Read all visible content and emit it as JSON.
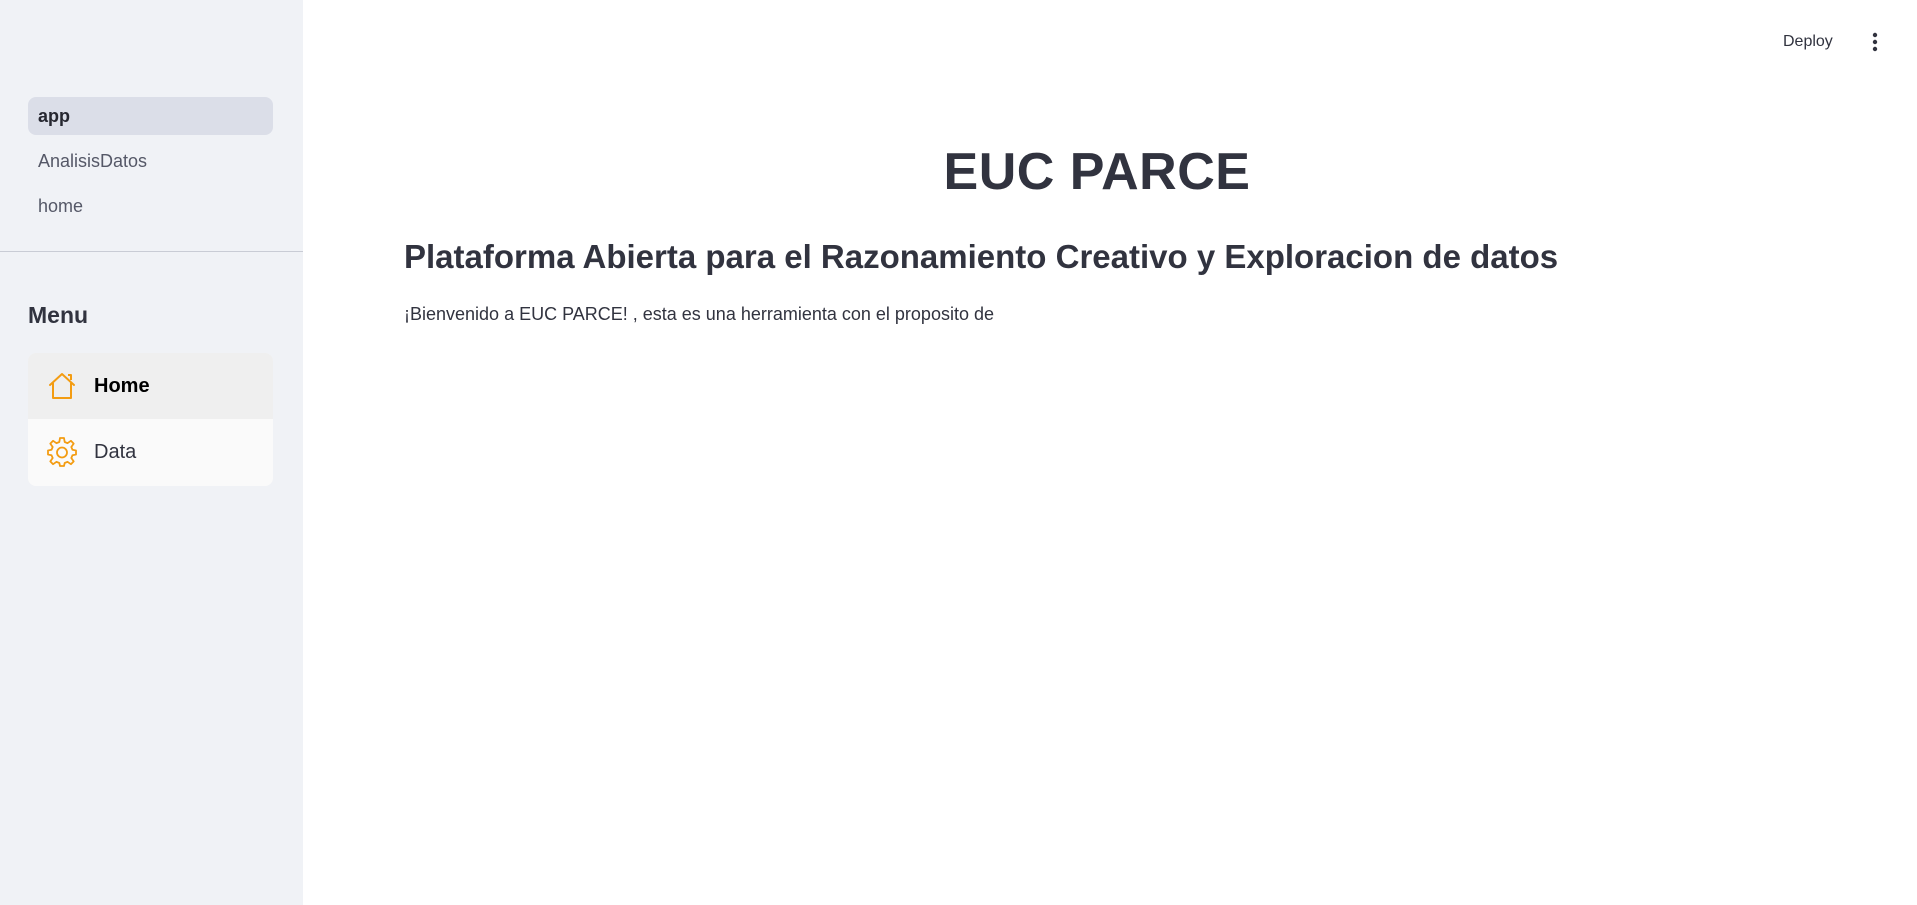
{
  "sidebar": {
    "pages": [
      {
        "label": "app",
        "active": true
      },
      {
        "label": "AnalisisDatos",
        "active": false
      },
      {
        "label": "home",
        "active": false
      }
    ],
    "menu": {
      "title": "Menu",
      "options": [
        {
          "label": "Home",
          "icon": "house-icon",
          "selected": true
        },
        {
          "label": "Data",
          "icon": "gear-icon",
          "selected": false
        }
      ],
      "icon_color": "#f39c12"
    }
  },
  "header": {
    "deploy_label": "Deploy",
    "menu_icon": "kebab-menu-icon"
  },
  "main": {
    "title": "EUC PARCE",
    "subtitle": "Plataforma Abierta para el Razonamiento Creativo y Exploracion de datos",
    "intro": "¡Bienvenido a EUC PARCE! , esta es una herramienta con el proposito de"
  }
}
